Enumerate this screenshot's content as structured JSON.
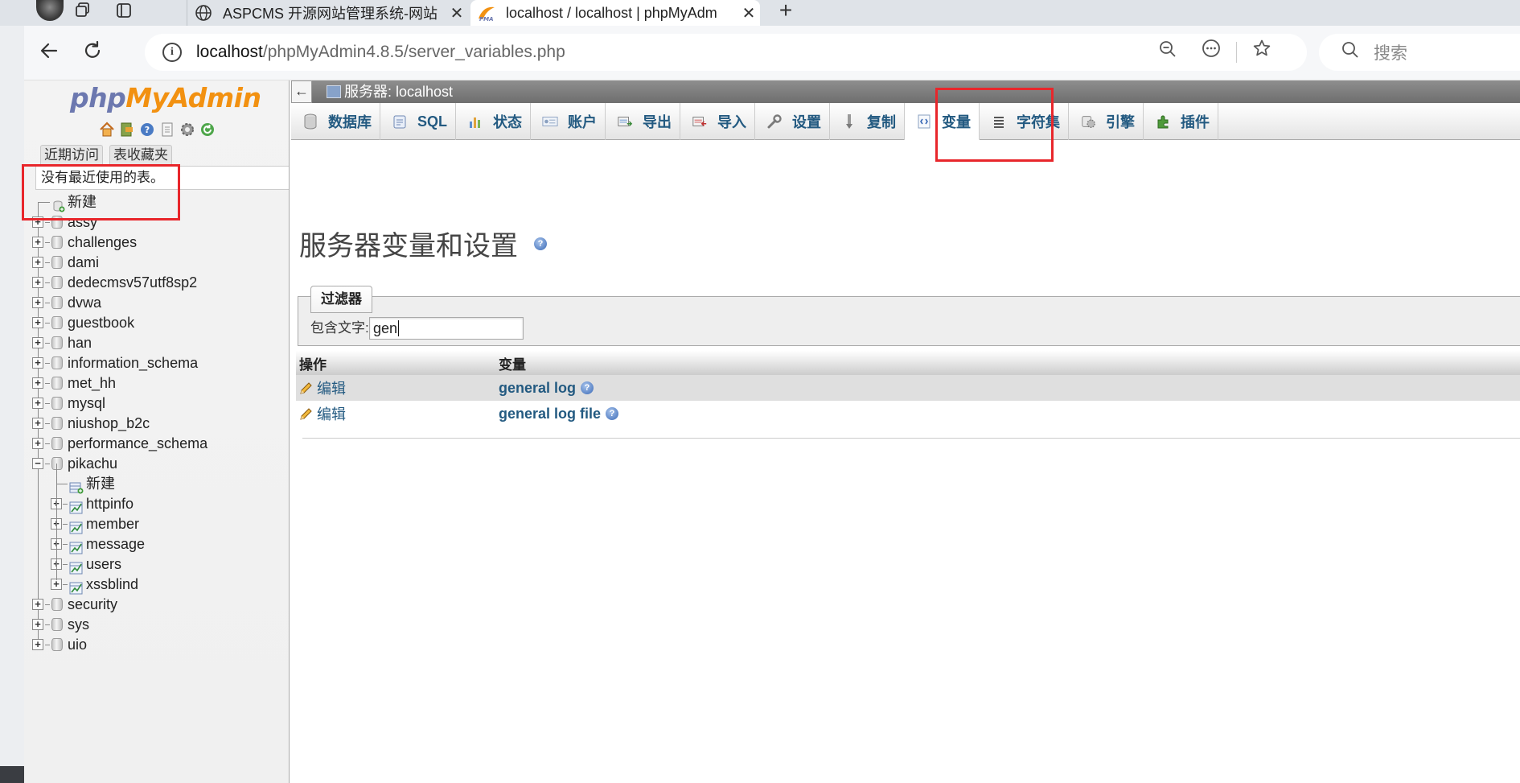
{
  "browser": {
    "tabs": [
      {
        "title": "ASPCMS 开源网站管理系统-网站",
        "active": false
      },
      {
        "title": "localhost / localhost | phpMyAdm",
        "active": true
      }
    ],
    "address": {
      "host": "localhost",
      "path": "/phpMyAdmin4.8.5/server_variables.php"
    },
    "search_placeholder": "搜索"
  },
  "logo": {
    "php": "php",
    "my": "My",
    "admin": "Admin"
  },
  "nav": {
    "recent_tabs": [
      "近期访问",
      "表收藏夹"
    ],
    "no_recent": "没有最近使用的表。",
    "new_label": "新建",
    "databases": [
      "assy",
      "challenges",
      "dami",
      "dedecmsv57utf8sp2",
      "dvwa",
      "guestbook",
      "han",
      "information_schema",
      "met_hh",
      "mysql",
      "niushop_b2c",
      "performance_schema",
      "pikachu",
      "security",
      "sys",
      "uio"
    ],
    "expanded_db": "pikachu",
    "pikachu_new": "新建",
    "pikachu_tables": [
      "httpinfo",
      "member",
      "message",
      "users",
      "xssblind"
    ]
  },
  "server": {
    "label": "服务器: localhost"
  },
  "menu": [
    {
      "label": "数据库",
      "icon": "database-icon"
    },
    {
      "label": "SQL",
      "icon": "sql-icon"
    },
    {
      "label": "状态",
      "icon": "status-icon"
    },
    {
      "label": "账户",
      "icon": "accounts-icon"
    },
    {
      "label": "导出",
      "icon": "export-icon"
    },
    {
      "label": "导入",
      "icon": "import-icon"
    },
    {
      "label": "设置",
      "icon": "settings-wrench-icon"
    },
    {
      "label": "复制",
      "icon": "replication-icon"
    },
    {
      "label": "变量",
      "icon": "variables-icon",
      "active": true
    },
    {
      "label": "字符集",
      "icon": "charset-icon"
    },
    {
      "label": "引擎",
      "icon": "engine-icon"
    },
    {
      "label": "插件",
      "icon": "plugin-icon"
    }
  ],
  "page": {
    "title": "服务器变量和设置"
  },
  "filter": {
    "legend": "过滤器",
    "label": "包含文字:",
    "value": "gen"
  },
  "table": {
    "headers": [
      "操作",
      "变量"
    ],
    "rows": [
      {
        "action": "编辑",
        "variable": "general log"
      },
      {
        "action": "编辑",
        "variable": "general log file"
      }
    ]
  },
  "colors": {
    "link": "#235a81",
    "annotation": "#e8262b"
  }
}
